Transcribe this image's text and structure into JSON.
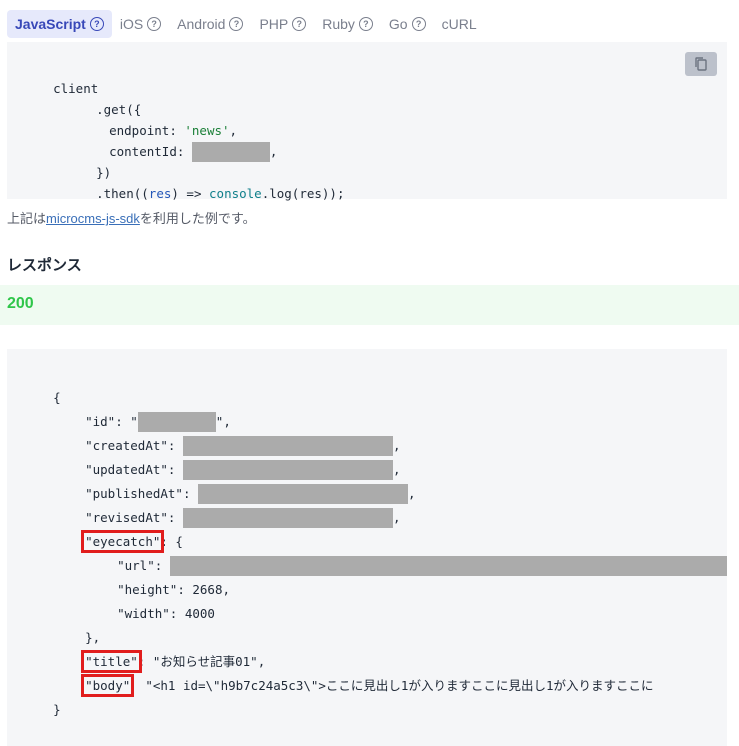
{
  "tabs": [
    {
      "label": "JavaScript",
      "active": true
    },
    {
      "label": "iOS"
    },
    {
      "label": "Android"
    },
    {
      "label": "PHP"
    },
    {
      "label": "Ruby"
    },
    {
      "label": "Go"
    },
    {
      "label": "cURL"
    }
  ],
  "help_icon_glyph": "?",
  "request_code": {
    "l1": "client",
    "l2": ".get({",
    "l3_key": "endpoint: ",
    "l3_val": "'news'",
    "l3_end": ",",
    "l4_key": "contentId: ",
    "l4_end": ",",
    "l5": "})",
    "l6_a": ".then((",
    "l6_res": "res",
    "l6_b": ") => ",
    "l6_fn": "console",
    "l6_c": ".log(res));"
  },
  "copy_icon": "copy-icon",
  "note": {
    "prefix": "上記は",
    "link": "microcms-js-sdk",
    "suffix": "を利用した例です。"
  },
  "response": {
    "heading": "レスポンス",
    "status_code": "200",
    "open_brace": "{",
    "id_key": "\"id\": \"",
    "id_end": "\",",
    "created_key": "\"createdAt\": ",
    "updated_key": "\"updatedAt\": ",
    "published_key": "\"publishedAt\": ",
    "revised_key": "\"revisedAt\": ",
    "comma": ",",
    "eyecatch_key": "\"eyecatch\"",
    "eyecatch_rest": ": {",
    "url_key": "\"url\": ",
    "height_line": "\"height\": 2668,",
    "width_line": "\"width\": 4000",
    "close_obj": "},",
    "title_key": "\"title\"",
    "title_rest": ": \"お知らせ記事01\",",
    "body_key": "\"body\"",
    "body_rest": "  \"<h1 id=\\\"h9b7c24a5c3\\\">ここに見出し1が入りますここに見出し1が入りますここに",
    "close_brace": "}"
  },
  "colors": {
    "tab_active_bg": "#e6e9fb",
    "tab_active_text": "#3848b8",
    "status_green": "#2fc64a",
    "highlight_red": "#e11d1d"
  }
}
